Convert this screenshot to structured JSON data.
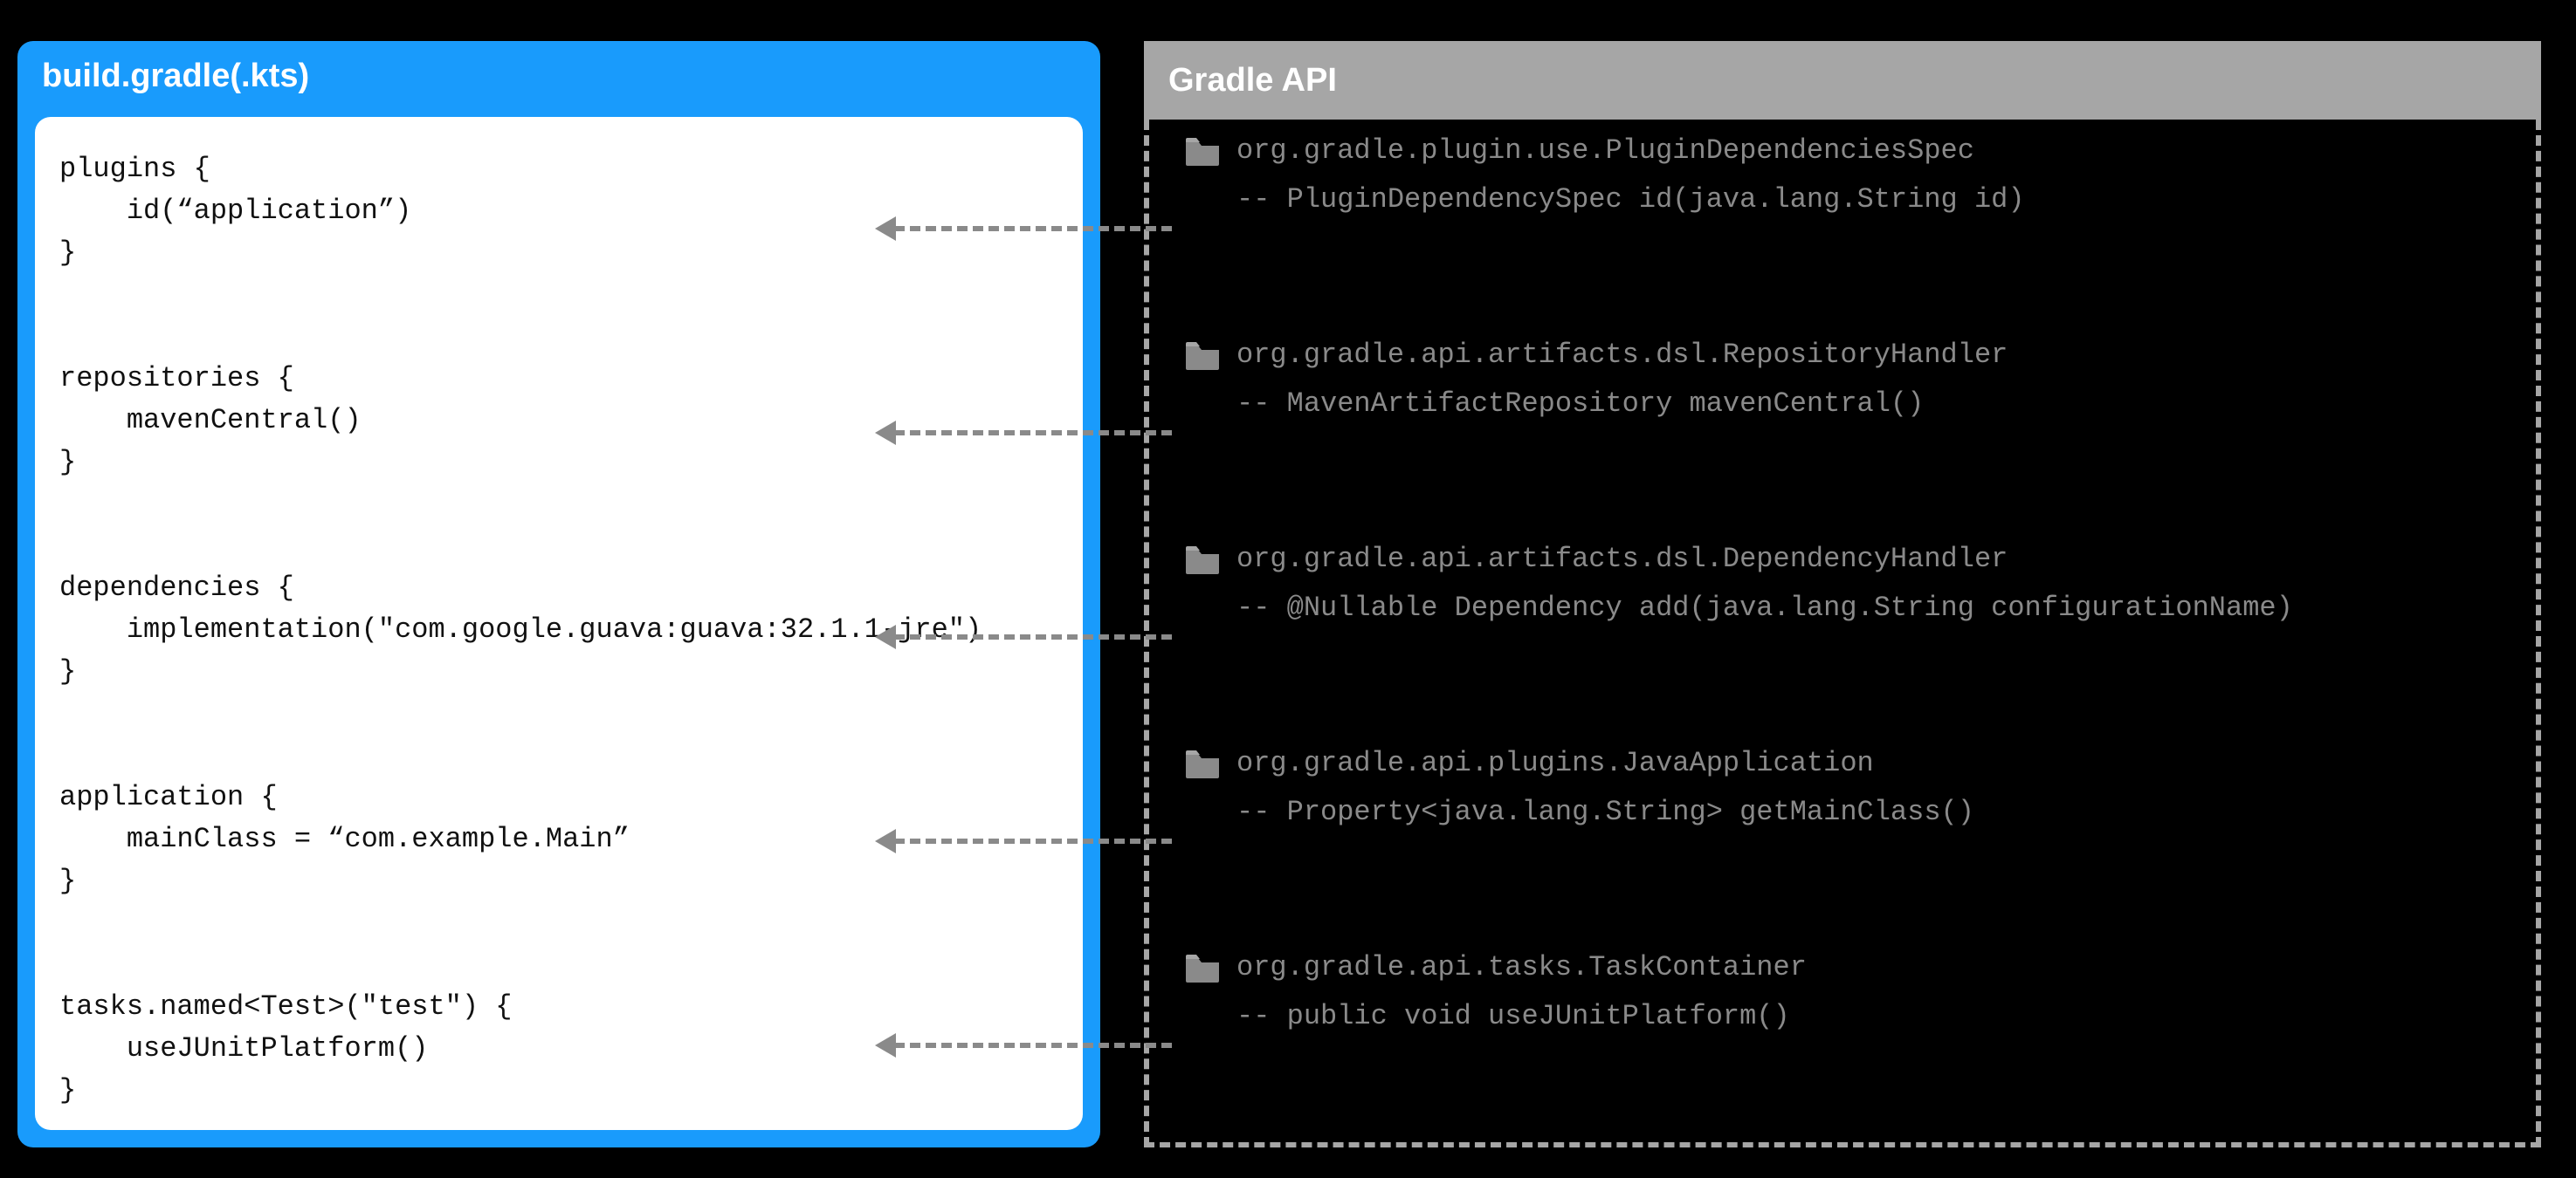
{
  "left": {
    "title": "build.gradle(.kts)",
    "code": "plugins {\n    id(“application”)\n}\n\n\nrepositories {\n    mavenCentral()\n}\n\n\ndependencies {\n    implementation(\"com.google.guava:guava:32.1.1-jre\")\n}\n\n\napplication {\n    mainClass = “com.example.Main”\n}\n\n\ntasks.named<Test>(\"test\") {\n    useJUnitPlatform()\n}"
  },
  "right": {
    "title": "Gradle API",
    "entries": [
      {
        "class": "org.gradle.plugin.use.PluginDependenciesSpec",
        "signature": "-- PluginDependencySpec id(java.lang.String id)"
      },
      {
        "class": "org.gradle.api.artifacts.dsl.RepositoryHandler",
        "signature": "-- MavenArtifactRepository mavenCentral()"
      },
      {
        "class": "org.gradle.api.artifacts.dsl.DependencyHandler",
        "signature": "-- @Nullable Dependency add(java.lang.String configurationName)"
      },
      {
        "class": "org.gradle.api.plugins.JavaApplication",
        "signature": "-- Property<java.lang.String> getMainClass()"
      },
      {
        "class": "org.gradle.api.tasks.TaskContainer",
        "signature": "-- public void useJUnitPlatform()"
      }
    ]
  }
}
